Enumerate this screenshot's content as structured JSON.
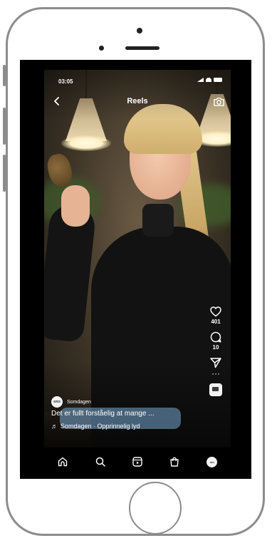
{
  "status_bar": {
    "time": "03:05"
  },
  "header": {
    "title": "Reels"
  },
  "actions": {
    "likes": "401",
    "comments": "10"
  },
  "post": {
    "author": "Somdagen",
    "avatar_text": "sms",
    "caption": "Det er fullt forståelig at mange ...",
    "audio_prefix": "♬",
    "audio": "Somdagen · Opprinnelig lyd"
  },
  "tabbar": {
    "profile_avatar_text": "sm"
  },
  "icons": {
    "back": "chevron-left-icon",
    "camera": "camera-icon",
    "like": "heart-icon",
    "comment": "comment-icon",
    "share": "send-icon",
    "more": "more-icon",
    "home": "home-icon",
    "search": "search-icon",
    "reels": "reels-icon",
    "shop": "shop-icon"
  },
  "colors": {
    "screen_background": "#000000",
    "phone_frame": "#8c8c8c",
    "caption_highlight": "#78aad2"
  }
}
